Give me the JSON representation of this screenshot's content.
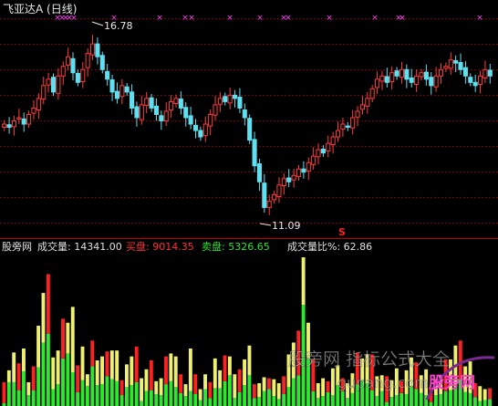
{
  "colors": {
    "background": "#000000",
    "up_candle": "#ff3c3c",
    "down_candle": "#5fe0f0",
    "grid": "#7a0000",
    "marker": "#ff40ff",
    "vol_green": "#2ee82e",
    "vol_yellow": "#f0f070",
    "vol_red": "#ff2020",
    "sell_signal": "#ff2020"
  },
  "price_panel": {
    "title": "飞亚达A (日线)",
    "high_label": "16.78",
    "low_label": "11.09",
    "signal_label": "S",
    "marker_glyph": "×"
  },
  "volume_panel": {
    "legend": [
      {
        "text": "股旁网",
        "color": "#e0e0e0"
      },
      {
        "text": "成交量: 14341.00",
        "color": "#e0e0e0"
      },
      {
        "text": "买盘: 9014.35",
        "color": "#ff3030"
      },
      {
        "text": "卖盘: 5326.65",
        "color": "#30e030"
      },
      {
        "text": "成交量比%: 62.86",
        "color": "#e0e0e0"
      }
    ],
    "watermark": "股旁网 指标公式大全",
    "watermark_url": "gupang.com",
    "logo_text": "股旁网"
  },
  "chart_data": [
    {
      "type": "candlestick",
      "title": "飞亚达A (日线)",
      "ylim": [
        10.8,
        17.4
      ],
      "annotations": [
        {
          "text": "16.78",
          "kind": "high",
          "value": 16.78
        },
        {
          "text": "11.09",
          "kind": "low",
          "value": 11.09
        }
      ],
      "close": [
        14.1,
        14.0,
        14.2,
        14.3,
        14.1,
        14.4,
        14.6,
        14.9,
        15.3,
        15.5,
        15.1,
        15.6,
        15.9,
        16.2,
        15.7,
        15.4,
        15.8,
        16.3,
        16.6,
        16.2,
        15.8,
        15.5,
        15.1,
        14.9,
        15.3,
        15.1,
        14.6,
        14.3,
        14.7,
        14.9,
        14.6,
        14.4,
        14.2,
        14.5,
        14.8,
        14.9,
        14.6,
        14.3,
        14.1,
        13.9,
        13.7,
        14.1,
        14.4,
        14.7,
        14.9,
        14.8,
        15.0,
        14.9,
        14.6,
        14.3,
        13.6,
        12.8,
        12.3,
        11.5,
        11.7,
        11.9,
        12.2,
        12.4,
        12.3,
        12.5,
        12.7,
        12.6,
        12.9,
        13.1,
        13.3,
        13.2,
        13.5,
        13.7,
        13.9,
        14.1,
        14.0,
        14.3,
        14.5,
        14.7,
        14.9,
        15.2,
        15.5,
        15.6,
        15.4,
        15.7,
        15.6,
        15.8,
        15.5,
        15.4,
        15.6,
        15.7,
        15.5,
        15.3,
        15.6,
        15.8,
        15.9,
        16.1,
        16.0,
        15.8,
        15.6,
        15.4,
        15.3,
        15.6,
        15.8,
        15.6
      ]
    },
    {
      "type": "bar",
      "title": "成交量",
      "series": [
        {
          "name": "买盘",
          "values": [
            21,
            12,
            30,
            27,
            23,
            13,
            24,
            42,
            50,
            60,
            32,
            34,
            40,
            31,
            66,
            27,
            34,
            12,
            26,
            25,
            28,
            25,
            29,
            31,
            15,
            23,
            29,
            36,
            23,
            22,
            30,
            13,
            17,
            28,
            28,
            31,
            19,
            12,
            43,
            20,
            11,
            15,
            16,
            30,
            18,
            26,
            19,
            24,
            23,
            26,
            30,
            14,
            14,
            14,
            11,
            17,
            16,
            18,
            33,
            36,
            45,
            48,
            36,
            32,
            15,
            18,
            11,
            27,
            20,
            13,
            15,
            20,
            32,
            22,
            29,
            36,
            20,
            16,
            26,
            17,
            27,
            12,
            24,
            29,
            27,
            18,
            26,
            14,
            16,
            19,
            32,
            31,
            42,
            39,
            26,
            32,
            14,
            15,
            11,
            11
          ]
        },
        {
          "name": "卖盘",
          "values": [
            3,
            24,
            24,
            16,
            35,
            11,
            16,
            39,
            64,
            73,
            17,
            22,
            48,
            53,
            34,
            14,
            26,
            20,
            40,
            21,
            22,
            30,
            27,
            25,
            11,
            19,
            21,
            24,
            5,
            15,
            16,
            12,
            11,
            22,
            25,
            19,
            13,
            10,
            15,
            12,
            6,
            17,
            8,
            18,
            18,
            25,
            31,
            8,
            14,
            21,
            31,
            8,
            9,
            15,
            17,
            10,
            7,
            12,
            19,
            28,
            31,
            102,
            48,
            15,
            8,
            10,
            14,
            11,
            21,
            15,
            8,
            13,
            22,
            26,
            23,
            16,
            10,
            15,
            4,
            9,
            11,
            13,
            12,
            20,
            17,
            13,
            11,
            4,
            11,
            12,
            15,
            16,
            19,
            27,
            14,
            13,
            9,
            5,
            6,
            7
          ]
        }
      ]
    }
  ]
}
